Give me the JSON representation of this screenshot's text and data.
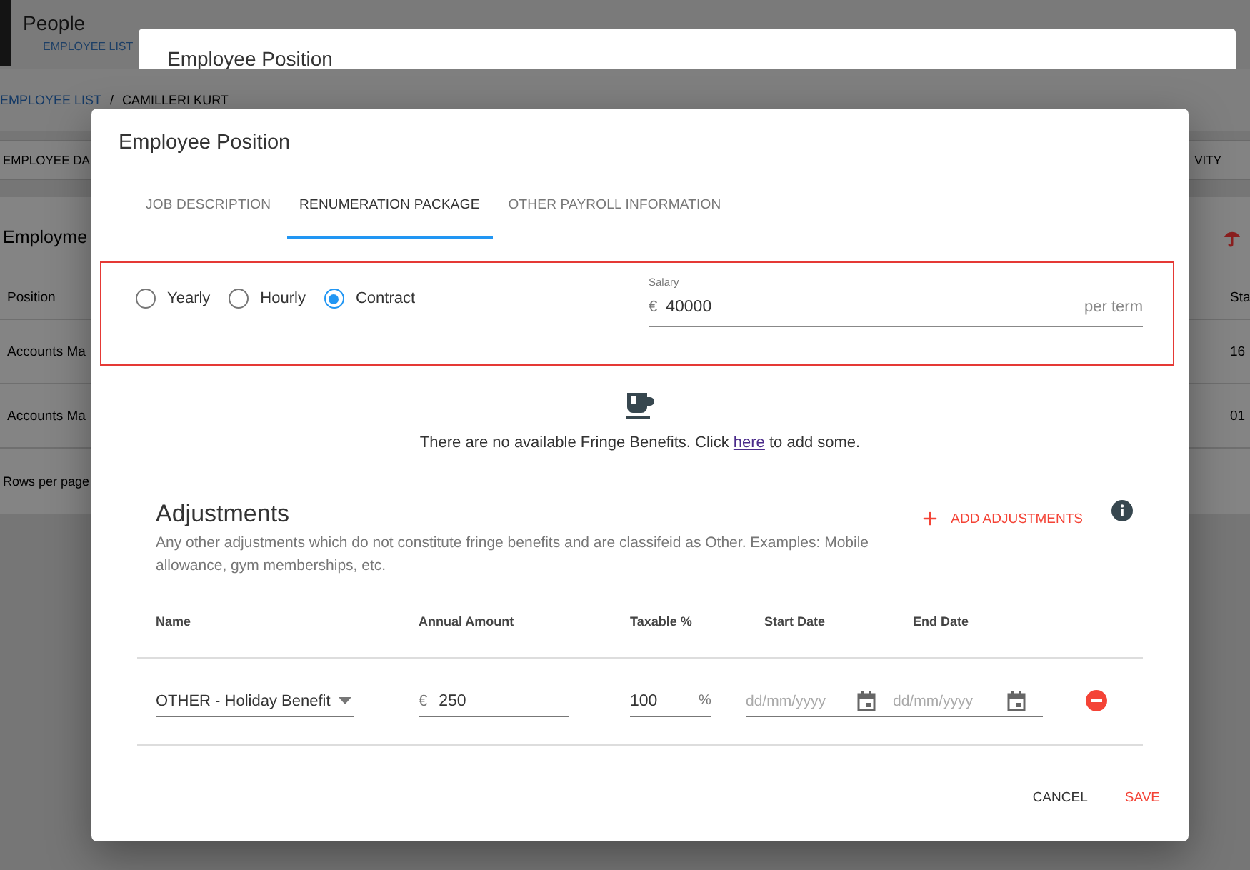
{
  "background_page": {
    "title": "People",
    "link": "EMPLOYEE LIST"
  },
  "background_dialog": {
    "title": "Employee Position"
  },
  "employee_page": {
    "breadcrumb": [
      {
        "label": "EMPLOYEE LIST",
        "kind": "link"
      },
      {
        "label": "CAMILLERI KURT",
        "kind": "current"
      }
    ],
    "breadcrumb_separator": "/",
    "tabs": [
      "EMPLOYEE DA",
      "VITY"
    ],
    "section_title": "Employme",
    "table": {
      "columns": [
        "Position",
        "Sta"
      ],
      "rows": [
        [
          "Accounts Ma",
          "16"
        ],
        [
          "Accounts Ma",
          "01"
        ]
      ]
    },
    "footer": "Rows per page"
  },
  "dialog": {
    "title": "Employee Position",
    "tabs": [
      {
        "label": "JOB DESCRIPTION",
        "selected": false
      },
      {
        "label": "RENUMERATION PACKAGE",
        "selected": true
      },
      {
        "label": "OTHER PAYROLL INFORMATION",
        "selected": false
      }
    ],
    "pay_types": [
      {
        "label": "Yearly",
        "selected": false
      },
      {
        "label": "Hourly",
        "selected": false
      },
      {
        "label": "Contract",
        "selected": true
      }
    ],
    "salary": {
      "label": "Salary",
      "currency": "€",
      "value": "40000",
      "suffix": "per term"
    },
    "fringe_benefits": {
      "text_before": "There are no available Fringe Benefits. Click ",
      "link": "here",
      "text_after": " to add some."
    },
    "adjustments": {
      "title": "Adjustments",
      "description": "Any other adjustments which do not constitute fringe benefits and are classifeid as Other. Examples: Mobile allowance, gym memberships, etc.",
      "add_button": "ADD ADJUSTMENTS",
      "columns": [
        "Name",
        "Annual Amount",
        "Taxable %",
        "Start Date",
        "End Date"
      ],
      "rows": [
        {
          "name": "OTHER - Holiday Benefit",
          "currency": "€",
          "amount": "250",
          "taxable": "100",
          "percent_sign": "%",
          "start_date_placeholder": "dd/mm/yyyy",
          "end_date_placeholder": "dd/mm/yyyy"
        }
      ]
    },
    "buttons": [
      {
        "label": "CANCEL",
        "kind": "neutral"
      },
      {
        "label": "SAVE",
        "kind": "primary"
      }
    ]
  }
}
